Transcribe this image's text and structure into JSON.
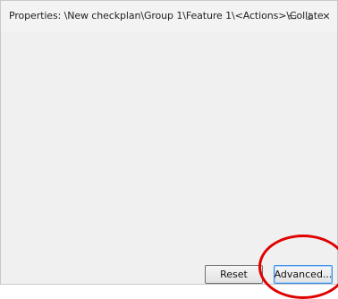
{
  "panel": {
    "title": "Properties: \\New checkplan\\Group 1\\Feature 1\\<Actions>\\Collate",
    "controls": [
      {
        "name": "restore-icon",
        "glyph": "▭"
      },
      {
        "name": "pin-icon",
        "glyph": "⊥"
      },
      {
        "name": "close-icon",
        "glyph": "✕"
      }
    ]
  },
  "footer": {
    "reset_label": "Reset",
    "advanced_label": "Advanced..."
  },
  "annotation": {
    "highlight_color": "#e00000"
  }
}
